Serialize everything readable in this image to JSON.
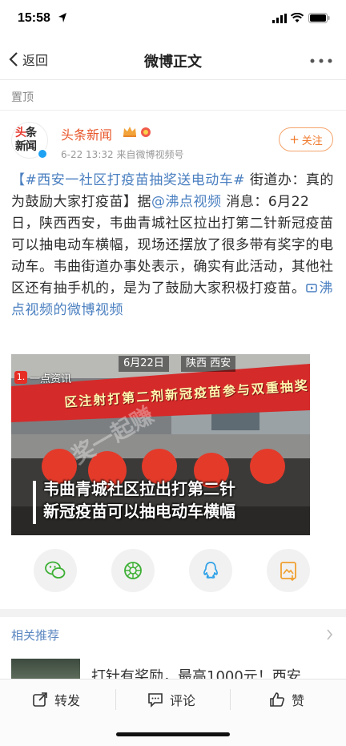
{
  "status_bar": {
    "time": "15:58"
  },
  "nav": {
    "back_label": "返回",
    "title": "微博正文"
  },
  "pinned": {
    "label": "置顶"
  },
  "author": {
    "avatar_line1_red": "头",
    "avatar_line1_black": "条",
    "avatar_line2": "新闻",
    "name": "头条新闻",
    "meta": "6-22 13:32  来自微博视频号",
    "follow_label": "关注"
  },
  "post": {
    "topic": "【#西安一社区打疫苗抽奖送电动车#",
    "text1": " 街道办：真的 为鼓励大家打疫苗】据",
    "mention": "@沸点视频",
    "text2": " 消息：6月22日，陕西西安，韦曲青城社区拉出打第二针新冠疫苗可以抽电动车横幅，现场还摆放了很多带有奖字的电动车。韦曲街道办事处表示，确实有此活动，其他社区还有抽手机的，是为了鼓励大家积极打疫苗。",
    "video_link": "沸点视频的微博视频"
  },
  "video": {
    "date_tag": "6月22日",
    "location_tag": "陕西 西安",
    "source_num": "1.",
    "source_label": "一点资讯",
    "banner_text": "区注射打第二剂新冠疫苗参与双重抽奖",
    "caption_line1": "韦曲青城社区拉出打第二针",
    "caption_line2": "新冠疫苗可以抽电动车横幅",
    "watermark": "奖一起赚"
  },
  "share": {
    "icons": [
      "wechat-icon",
      "moments-icon",
      "qq-icon",
      "save-image-icon"
    ]
  },
  "related": {
    "title": "相关推荐",
    "item_text": "打针有奖励，最高1000元！西安"
  },
  "toolbar": {
    "repost": "转发",
    "comment": "评论",
    "like": "赞"
  },
  "colors": {
    "accent_orange": "#e8562a",
    "link_blue": "#4a7fc0",
    "banner_red": "#d42a2a"
  }
}
